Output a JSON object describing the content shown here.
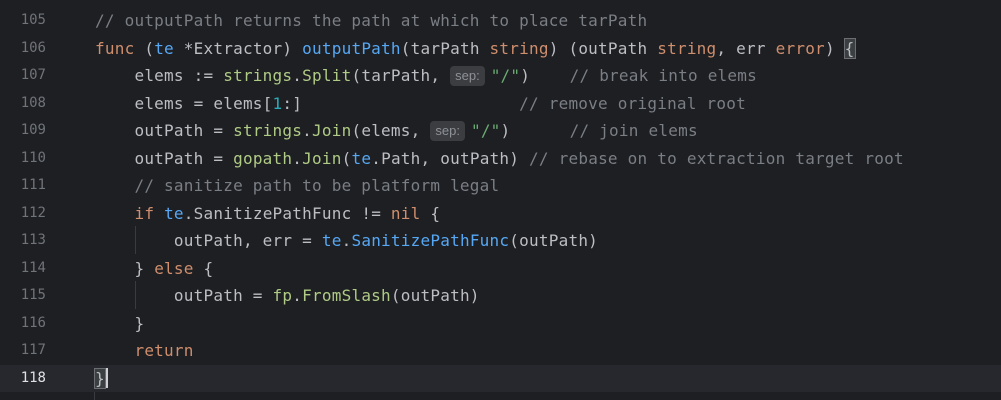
{
  "editor": {
    "current_line": 118,
    "lines": [
      {
        "num": "105",
        "tokens": [
          {
            "t": "// outputPath returns the path at which to place tarPath",
            "c": "cm"
          }
        ]
      },
      {
        "num": "106",
        "tokens": [
          {
            "t": "func",
            "c": "kw"
          },
          {
            "t": " (",
            "c": ""
          },
          {
            "t": "te",
            "c": "rcv"
          },
          {
            "t": " *Extractor) ",
            "c": ""
          },
          {
            "t": "outputPath",
            "c": "fn"
          },
          {
            "t": "(tarPath ",
            "c": ""
          },
          {
            "t": "string",
            "c": "kw"
          },
          {
            "t": ") (outPath ",
            "c": ""
          },
          {
            "t": "string",
            "c": "kw"
          },
          {
            "t": ", err ",
            "c": ""
          },
          {
            "t": "error",
            "c": "kw"
          },
          {
            "t": ") ",
            "c": ""
          },
          {
            "t": "{",
            "c": "brace"
          }
        ]
      },
      {
        "num": "107",
        "tokens": [
          {
            "t": "    elems := ",
            "c": ""
          },
          {
            "t": "strings",
            "c": "pkg"
          },
          {
            "t": ".",
            "c": ""
          },
          {
            "t": "Split",
            "c": "pkg"
          },
          {
            "t": "(tarPath, ",
            "c": ""
          },
          {
            "t": "sep:",
            "c": "hint"
          },
          {
            "t": "\"/\"",
            "c": "str"
          },
          {
            "t": ")    ",
            "c": ""
          },
          {
            "t": "// break into elems",
            "c": "cm"
          }
        ]
      },
      {
        "num": "108",
        "tokens": [
          {
            "t": "    elems = elems[",
            "c": ""
          },
          {
            "t": "1",
            "c": "num"
          },
          {
            "t": ":]                      ",
            "c": ""
          },
          {
            "t": "// remove original root",
            "c": "cm"
          }
        ]
      },
      {
        "num": "109",
        "tokens": [
          {
            "t": "    outPath = ",
            "c": ""
          },
          {
            "t": "strings",
            "c": "pkg"
          },
          {
            "t": ".",
            "c": ""
          },
          {
            "t": "Join",
            "c": "pkg"
          },
          {
            "t": "(elems, ",
            "c": ""
          },
          {
            "t": "sep:",
            "c": "hint"
          },
          {
            "t": "\"/\"",
            "c": "str"
          },
          {
            "t": ")      ",
            "c": ""
          },
          {
            "t": "// join elems",
            "c": "cm"
          }
        ]
      },
      {
        "num": "110",
        "tokens": [
          {
            "t": "    outPath = ",
            "c": ""
          },
          {
            "t": "gopath",
            "c": "pkg"
          },
          {
            "t": ".",
            "c": ""
          },
          {
            "t": "Join",
            "c": "pkg"
          },
          {
            "t": "(",
            "c": ""
          },
          {
            "t": "te",
            "c": "rcv"
          },
          {
            "t": ".Path, outPath) ",
            "c": ""
          },
          {
            "t": "// rebase on to extraction target root",
            "c": "cm"
          }
        ]
      },
      {
        "num": "111",
        "tokens": [
          {
            "t": "    ",
            "c": ""
          },
          {
            "t": "// sanitize path to be platform legal",
            "c": "cm"
          }
        ]
      },
      {
        "num": "112",
        "tokens": [
          {
            "t": "    ",
            "c": ""
          },
          {
            "t": "if",
            "c": "kw"
          },
          {
            "t": " ",
            "c": ""
          },
          {
            "t": "te",
            "c": "rcv"
          },
          {
            "t": ".SanitizePathFunc != ",
            "c": ""
          },
          {
            "t": "nil",
            "c": "kw"
          },
          {
            "t": " {",
            "c": ""
          }
        ]
      },
      {
        "num": "113",
        "tokens": [
          {
            "t": "        outPath, err = ",
            "c": ""
          },
          {
            "t": "te",
            "c": "rcv"
          },
          {
            "t": ".",
            "c": ""
          },
          {
            "t": "SanitizePathFunc",
            "c": "mcall"
          },
          {
            "t": "(outPath)",
            "c": ""
          }
        ]
      },
      {
        "num": "114",
        "tokens": [
          {
            "t": "    } ",
            "c": ""
          },
          {
            "t": "else",
            "c": "kw"
          },
          {
            "t": " {",
            "c": ""
          }
        ]
      },
      {
        "num": "115",
        "tokens": [
          {
            "t": "        outPath = ",
            "c": ""
          },
          {
            "t": "fp",
            "c": "pkg"
          },
          {
            "t": ".",
            "c": ""
          },
          {
            "t": "FromSlash",
            "c": "pkg"
          },
          {
            "t": "(outPath)",
            "c": ""
          }
        ]
      },
      {
        "num": "116",
        "tokens": [
          {
            "t": "    }",
            "c": ""
          }
        ]
      },
      {
        "num": "117",
        "tokens": [
          {
            "t": "    ",
            "c": ""
          },
          {
            "t": "return",
            "c": "kw"
          }
        ]
      },
      {
        "num": "118",
        "tokens": [
          {
            "t": "}",
            "c": "brace"
          },
          {
            "t": "",
            "c": "caret"
          }
        ]
      }
    ]
  }
}
